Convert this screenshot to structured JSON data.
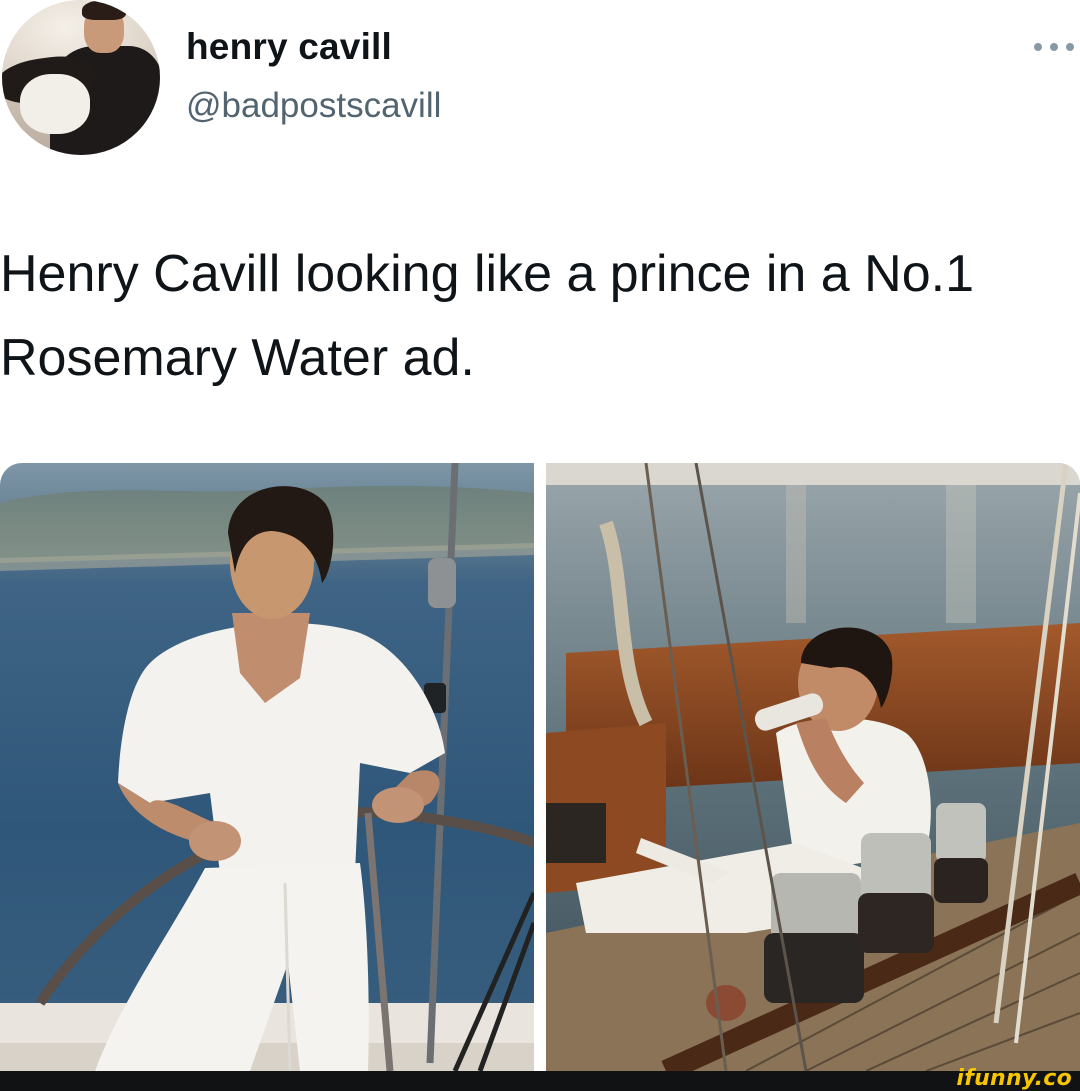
{
  "tweet": {
    "display_name": "henry cavill",
    "handle": "@badpostscavill",
    "text": "Henry Cavill looking like a prince in a No.1 Rosemary Water ad.",
    "more_icon": "ellipsis-icon"
  },
  "media": {
    "left_photo": "man-at-ship-wheel-photo",
    "right_photo": "man-drinking-on-boat-photo"
  },
  "watermark": {
    "text": "ifunny.co",
    "color": "#f7c600"
  },
  "colors": {
    "name": "#0f1419",
    "handle": "#536471",
    "more": "#8899a6"
  }
}
